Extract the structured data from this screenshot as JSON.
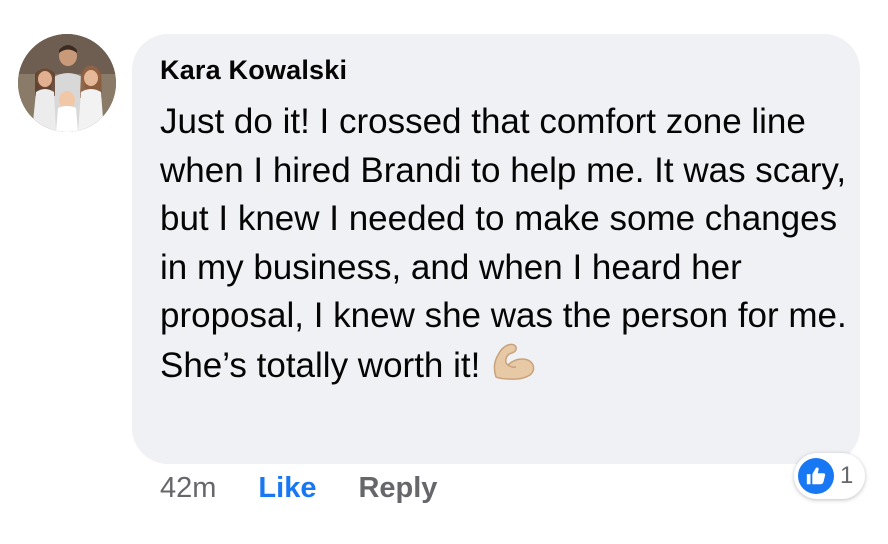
{
  "comment": {
    "author": "Kara Kowalski",
    "text": "Just do it! I crossed that comfort zone line when I hired Brandi to help me. It was scary, but I knew I needed to make some changes in my business, and when I heard her proposal, I knew she was the person for me. She’s totally worth it!",
    "emoji": "flexed-biceps",
    "timestamp": "42m",
    "like_label": "Like",
    "reply_label": "Reply",
    "reaction_count": "1",
    "reaction_type": "like-icon"
  },
  "colors": {
    "bubble": "#eff1f4",
    "like_blue": "#1877f2",
    "meta_gray": "#65676b",
    "text": "#050505"
  }
}
